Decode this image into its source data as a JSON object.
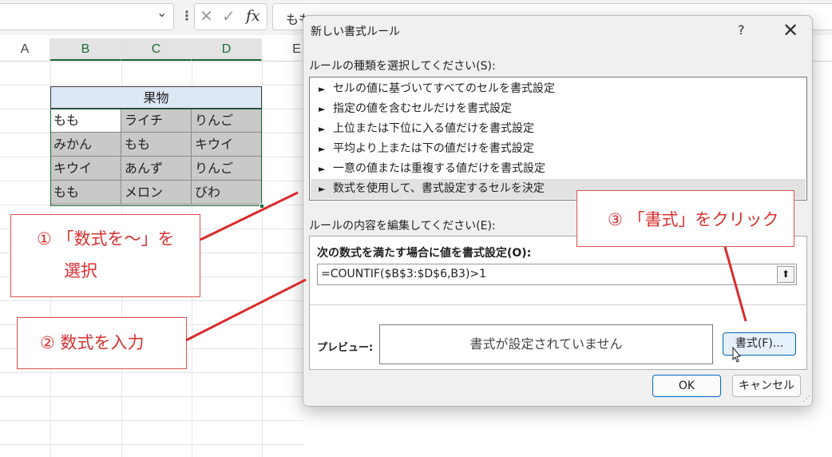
{
  "excel": {
    "formula_bar": {
      "fx_symbol": "fx",
      "cancel_symbol": "✕",
      "enter_symbol": "✓",
      "content": "もも"
    },
    "columns": [
      "A",
      "B",
      "C",
      "D",
      "E"
    ],
    "table": {
      "title": "果物",
      "rows": [
        [
          "もも",
          "ライチ",
          "りんご"
        ],
        [
          "みかん",
          "もも",
          "キウイ"
        ],
        [
          "キウイ",
          "あんず",
          "りんご"
        ],
        [
          "もも",
          "メロン",
          "びわ"
        ]
      ]
    }
  },
  "callouts": {
    "c1_line1": "① 「数式を～」を",
    "c1_line2": "選択",
    "c2": "② 数式を入力",
    "c3": "③ 「書式」をクリック"
  },
  "dialog": {
    "title": "新しい書式ルール",
    "help": "?",
    "close": "✕",
    "rule_type_label": "ルールの種類を選択してください(S):",
    "rule_types": [
      "セルの値に基づいてすべてのセルを書式設定",
      "指定の値を含むセルだけを書式設定",
      "上位または下位に入る値だけを書式設定",
      "平均より上または下の値だけを書式設定",
      "一意の値または重複する値だけを書式設定",
      "数式を使用して、書式設定するセルを決定"
    ],
    "rule_arrow": "►",
    "rule_edit_label": "ルールの内容を編集してください(E):",
    "formula_label": "次の数式を満たす場合に値を書式設定(O):",
    "formula_value": "=COUNTIF($B$3:$D$6,B3)>1",
    "preview_label": "プレビュー:",
    "preview_text": "書式が設定されていません",
    "format_button": "書式(F)...",
    "ok_button": "OK",
    "cancel_button": "キャンセル"
  }
}
